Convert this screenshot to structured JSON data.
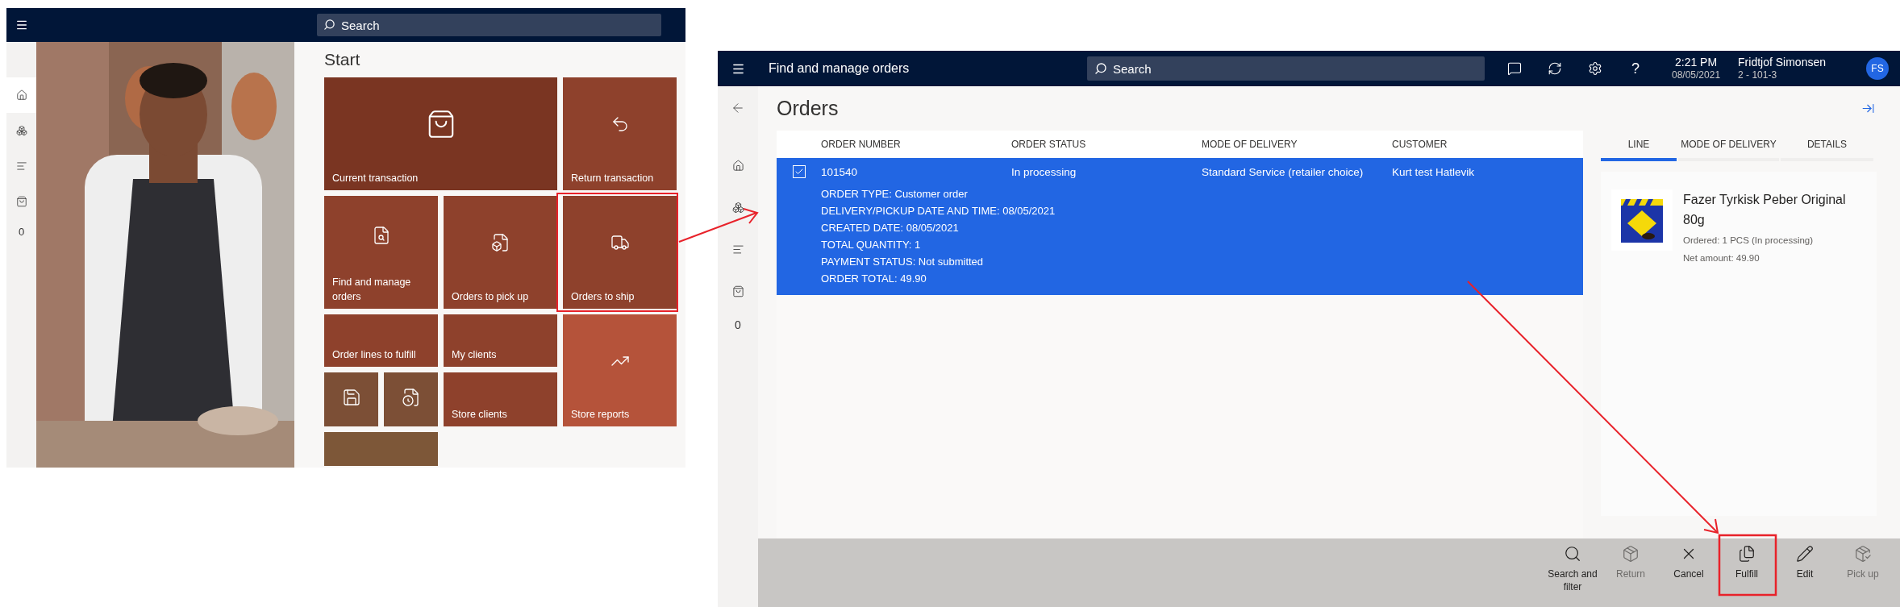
{
  "start_screen": {
    "search": {
      "placeholder": "Search"
    },
    "rail": {
      "items": [
        {
          "selected": true
        },
        {
          "selected": false
        },
        {
          "selected": false
        },
        {
          "selected": false
        }
      ],
      "count": "0"
    },
    "heading": "Start",
    "tiles": [
      {
        "kind": "wide",
        "label": "Current transaction",
        "color": "#7a3522"
      },
      {
        "kind": "normal",
        "label": "Return transaction",
        "color": "#8e412c"
      },
      {
        "kind": "normal",
        "label": "Find and manage orders",
        "color": "#8e412c"
      },
      {
        "kind": "normal",
        "label": "Orders to pick up",
        "color": "#8e412c"
      },
      {
        "kind": "normal",
        "label": "Orders to ship",
        "color": "#8e412c"
      },
      {
        "kind": "normal",
        "label": "Order lines to fulfill",
        "color": "#8e412c"
      },
      {
        "kind": "normal",
        "label": "My clients",
        "color": "#8e412c"
      },
      {
        "kind": "tall",
        "label": "Store reports",
        "color": "#b5533a"
      },
      {
        "kind": "small",
        "color": "#7c4f36"
      },
      {
        "kind": "small",
        "color": "#7c4f36"
      },
      {
        "kind": "normal",
        "label": "Store clients",
        "color": "#8e412c"
      },
      {
        "kind": "normal",
        "color": "#7d5738"
      }
    ]
  },
  "orders_screen": {
    "header": {
      "title": "Find and manage orders",
      "search": {
        "placeholder": "Search"
      },
      "help": "?",
      "time": "2:21 PM",
      "date": "08/05/2021",
      "user": "Fridtjof Simonsen",
      "store": "2 - 101-3",
      "avatar": "FS"
    },
    "rail": {
      "count": "0"
    },
    "title": "Orders",
    "table": {
      "columns": [
        "ORDER NUMBER",
        "ORDER STATUS",
        "MODE OF DELIVERY",
        "CUSTOMER"
      ],
      "rows": [
        {
          "selected": true,
          "checked": true,
          "cells": [
            "101540",
            "In processing",
            "Standard Service (retailer choice)",
            "Kurt test Hatlevik"
          ],
          "details": [
            "ORDER TYPE: Customer order",
            "DELIVERY/PICKUP DATE AND TIME: 08/05/2021",
            "CREATED DATE: 08/05/2021",
            "TOTAL QUANTITY: 1",
            "PAYMENT STATUS: Not submitted",
            "ORDER TOTAL: 49.90"
          ]
        }
      ]
    },
    "tabs": [
      {
        "label": "LINE",
        "selected": true
      },
      {
        "label": "MODE OF DELIVERY",
        "selected": false
      },
      {
        "label": "DETAILS",
        "selected": false
      }
    ],
    "line": {
      "product": "Fazer Tyrkisk Peber Original 80g",
      "ordered": "Ordered: 1 PCS (In processing)",
      "net_amount": "Net amount: 49.90"
    },
    "actions": [
      {
        "label": "Search and filter",
        "disabled": false
      },
      {
        "label": "Return",
        "disabled": true
      },
      {
        "label": "Cancel",
        "disabled": false
      },
      {
        "label": "Fulfill",
        "disabled": false
      },
      {
        "label": "Edit",
        "disabled": false
      },
      {
        "label": "Pick up",
        "disabled": true
      }
    ]
  }
}
